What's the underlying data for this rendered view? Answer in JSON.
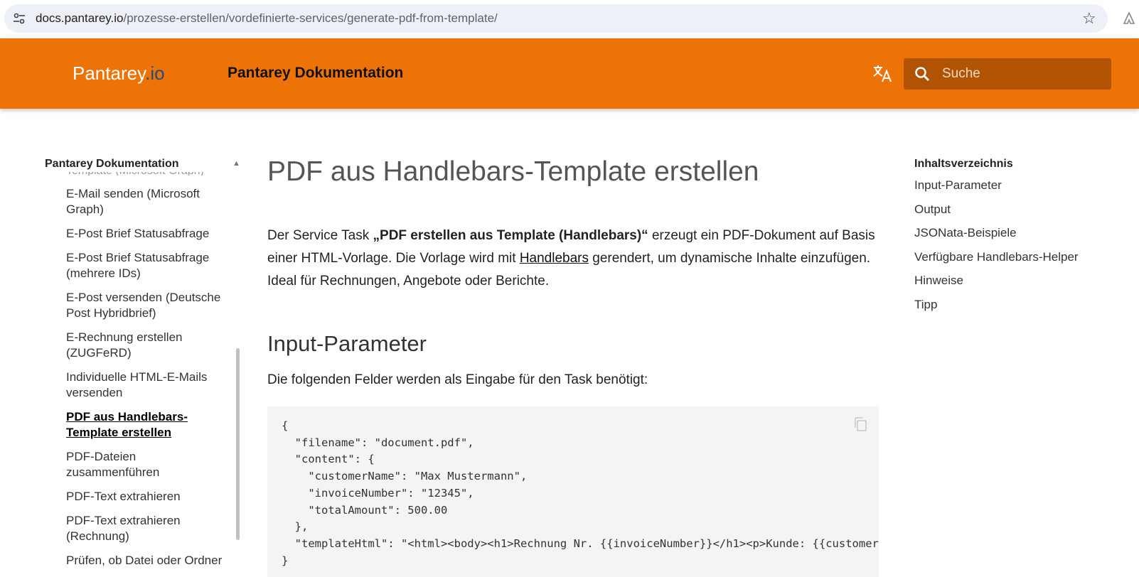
{
  "browser": {
    "url_host": "docs.pantarey.io",
    "url_path": "/prozesse-erstellen/vordefinierte-services/generate-pdf-from-template/"
  },
  "header": {
    "logo_main": "Pantarey",
    "logo_suffix": ".io",
    "site_title": "Pantarey Dokumentation",
    "search_placeholder": "Suche"
  },
  "sidebar": {
    "title": "Pantarey Dokumentation",
    "partial_item": "Template (Microsoft Graph)",
    "items": [
      {
        "label": "E-Mail senden (Microsoft Graph)"
      },
      {
        "label": "E-Post Brief Statusabfrage"
      },
      {
        "label": "E-Post Brief Statusabfrage (mehrere IDs)"
      },
      {
        "label": "E-Post versenden (Deutsche Post Hybridbrief)"
      },
      {
        "label": "E-Rechnung erstellen (ZUGFeRD)"
      },
      {
        "label": "Individuelle HTML-E-Mails versenden"
      },
      {
        "label": "PDF aus Handlebars-Template erstellen"
      },
      {
        "label": "PDF-Dateien zusammenführen"
      },
      {
        "label": "PDF-Text extrahieren"
      },
      {
        "label": "PDF-Text extrahieren (Rechnung)"
      },
      {
        "label": "Prüfen, ob Datei oder Ordner existiert"
      }
    ]
  },
  "main": {
    "title": "PDF aus Handlebars-Template erstellen",
    "intro_1": "Der Service Task ",
    "intro_bold": "„PDF erstellen aus Template (Handlebars)“",
    "intro_2": " erzeugt ein PDF-Dokument auf Basis einer HTML-Vorlage. Die Vorlage wird mit ",
    "intro_link": "Handlebars",
    "intro_3": " gerendert, um dynamische Inhalte einzufügen. Ideal für Rechnungen, Angebote oder Berichte.",
    "section_heading": "Input-Parameter",
    "section_lead": "Die folgenden Felder werden als Eingabe für den Task benötigt:",
    "code": "{\n  \"filename\": \"document.pdf\",\n  \"content\": {\n    \"customerName\": \"Max Mustermann\",\n    \"invoiceNumber\": \"12345\",\n    \"totalAmount\": 500.00\n  },\n  \"templateHtml\": \"<html><body><h1>Rechnung Nr. {{invoiceNumber}}</h1><p>Kunde: {{customerName}}</p></body></html>\"\n}"
  },
  "toc": {
    "title": "Inhaltsverzeichnis",
    "items": [
      {
        "label": "Input-Parameter"
      },
      {
        "label": "Output"
      },
      {
        "label": "JSONata-Beispiele"
      },
      {
        "label": "Verfügbare Handlebars-Helper"
      },
      {
        "label": "Hinweise"
      },
      {
        "label": "Tipp"
      }
    ]
  },
  "colors": {
    "header_bg": "#ee7307",
    "search_bg": "#b05303",
    "code_bg": "#f4f4f4"
  },
  "icons": [
    "tune-icon",
    "star-icon",
    "extension-icon",
    "translate-icon",
    "search-icon",
    "copy-icon",
    "chevron-up-icon"
  ]
}
